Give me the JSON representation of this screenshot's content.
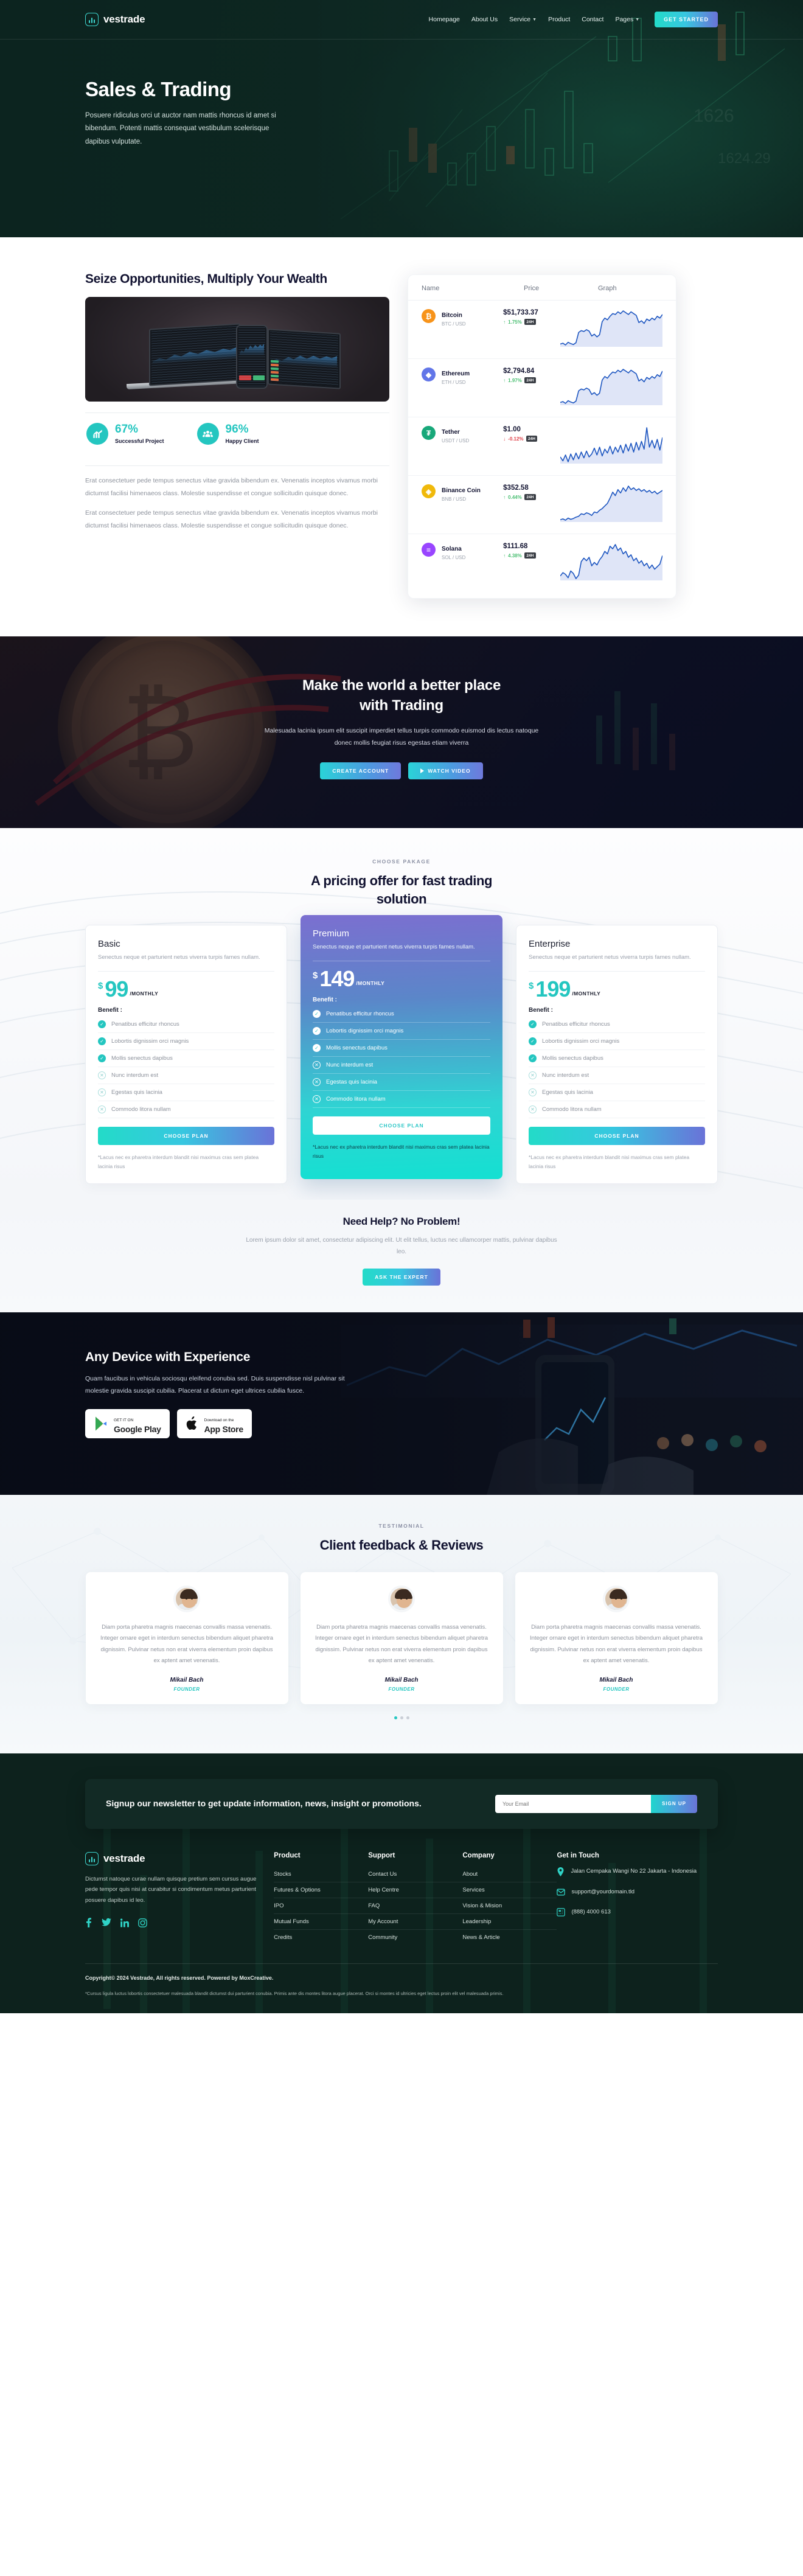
{
  "nav": {
    "brand": "vestrade",
    "items": [
      {
        "label": "Homepage",
        "caret": false
      },
      {
        "label": "About Us",
        "caret": false
      },
      {
        "label": "Service",
        "caret": true
      },
      {
        "label": "Product",
        "caret": false
      },
      {
        "label": "Contact",
        "caret": false
      },
      {
        "label": "Pages",
        "caret": true
      }
    ],
    "cta": "GET STARTED"
  },
  "hero": {
    "title": "Sales & Trading",
    "subtitle": "Posuere ridiculus orci ut auctor nam mattis rhoncus id amet si bibendum. Potenti mattis consequat vestibulum scelerisque dapibus vulputate."
  },
  "seize": {
    "title": "Seize Opportunities, Multiply Your Wealth",
    "stats": [
      {
        "value": "67%",
        "label": "Successful Project",
        "icon": "growth-chart-icon"
      },
      {
        "value": "96%",
        "label": "Happy Client",
        "icon": "people-group-icon"
      }
    ],
    "paragraphs": [
      "Erat consectetuer pede tempus senectus vitae gravida bibendum ex. Venenatis inceptos vivamus morbi dictumst facilisi himenaeos class. Molestie suspendisse et congue sollicitudin quisque donec.",
      "Erat consectetuer pede tempus senectus vitae gravida bibendum ex. Venenatis inceptos vivamus morbi dictumst facilisi himenaeos class. Molestie suspendisse et congue sollicitudin quisque donec."
    ]
  },
  "crypto": {
    "headers": {
      "name": "Name",
      "price": "Price",
      "graph": "Graph"
    },
    "rows": [
      {
        "symbol": "₿",
        "color": "#f7931a",
        "name": "Bitcoin",
        "pair": "BTC / USD",
        "price": "$51,733.37",
        "change": "1.75%",
        "direction": "up",
        "period": "24H"
      },
      {
        "symbol": "◆",
        "color": "#6276e8",
        "name": "Ethereum",
        "pair": "ETH / USD",
        "price": "$2,794.84",
        "change": "1.97%",
        "direction": "up",
        "period": "24H"
      },
      {
        "symbol": "₮",
        "color": "#18a87a",
        "name": "Tether",
        "pair": "USDT / USD",
        "price": "$1.00",
        "change": "-0.12%",
        "direction": "down",
        "period": "24H"
      },
      {
        "symbol": "◈",
        "color": "#f0b90b",
        "name": "Binance Coin",
        "pair": "BNB / USD",
        "price": "$352.58",
        "change": "0.44%",
        "direction": "up",
        "period": "24H"
      },
      {
        "symbol": "≡",
        "color": "#9945ff",
        "name": "Solana",
        "pair": "SOL / USD",
        "price": "$111.68",
        "change": "4.38%",
        "direction": "up",
        "period": "24H"
      }
    ]
  },
  "trading_cta": {
    "title_line1": "Make the world a better place",
    "title_line2": "with Trading",
    "text": "Malesuada lacinia ipsum elit suscipit imperdiet tellus turpis commodo euismod dis lectus natoque donec mollis feugiat risus egestas etiam viverra",
    "btn_primary": "CREATE ACCOUNT",
    "btn_secondary": "WATCH VIDEO"
  },
  "pricing": {
    "eyebrow": "CHOOSE PAKAGE",
    "heading_line1": "A pricing offer for fast trading",
    "heading_line2": "solution",
    "note": "*Lacus nec ex pharetra interdum blandit nisi maximus cras sem platea lacinia risus",
    "benefit_title": "Benefit :",
    "button": "CHOOSE PLAN",
    "per": "/MONTHLY",
    "currency": "$",
    "plans": [
      {
        "name": "Basic",
        "desc": "Senectus neque et parturient netus viverra turpis fames nullam.",
        "amount": "99",
        "benefits": [
          {
            "text": "Penatibus efficitur rhoncus",
            "included": true
          },
          {
            "text": "Lobortis dignissim orci magnis",
            "included": true
          },
          {
            "text": "Mollis senectus dapibus",
            "included": true
          },
          {
            "text": "Nunc interdum est",
            "included": false
          },
          {
            "text": "Egestas quis lacinia",
            "included": false
          },
          {
            "text": "Commodo litora nullam",
            "included": false
          }
        ]
      },
      {
        "name": "Premium",
        "desc": "Senectus neque et parturient netus viverra turpis fames nullam.",
        "amount": "149",
        "benefits": [
          {
            "text": "Penatibus efficitur rhoncus",
            "included": true
          },
          {
            "text": "Lobortis dignissim orci magnis",
            "included": true
          },
          {
            "text": "Mollis senectus dapibus",
            "included": true
          },
          {
            "text": "Nunc interdum est",
            "included": false
          },
          {
            "text": "Egestas quis lacinia",
            "included": false
          },
          {
            "text": "Commodo litora nullam",
            "included": false
          }
        ]
      },
      {
        "name": "Enterprise",
        "desc": "Senectus neque et parturient netus viverra turpis fames nullam.",
        "amount": "199",
        "benefits": [
          {
            "text": "Penatibus efficitur rhoncus",
            "included": true
          },
          {
            "text": "Lobortis dignissim orci magnis",
            "included": true
          },
          {
            "text": "Mollis senectus dapibus",
            "included": true
          },
          {
            "text": "Nunc interdum est",
            "included": false
          },
          {
            "text": "Egestas quis lacinia",
            "included": false
          },
          {
            "text": "Commodo litora nullam",
            "included": false
          }
        ]
      }
    ]
  },
  "help": {
    "title": "Need Help? No Problem!",
    "text": "Lorem ipsum dolor sit amet, consectetur adipiscing elit. Ut elit tellus, luctus nec ullamcorper mattis, pulvinar dapibus leo.",
    "button": "ASK THE EXPERT"
  },
  "device": {
    "title": "Any Device with Experience",
    "text": "Quam faucibus in vehicula sociosqu eleifend conubia sed. Duis suspendisse nisl pulvinar sit molestie gravida suscipit cubilia. Placerat ut dictum eget ultrices cubilia fusce.",
    "stores": [
      {
        "small": "GET IT ON",
        "big": "Google Play",
        "icon": "google-play-icon"
      },
      {
        "small": "Download on the",
        "big": "App Store",
        "icon": "apple-icon"
      }
    ]
  },
  "testimonial": {
    "eyebrow": "TESTIMONIAL",
    "heading": "Client feedback & Reviews",
    "cards": [
      {
        "quote": "Diam porta pharetra magnis maecenas convallis massa venenatis. Integer ornare eget in interdum senectus bibendum aliquet pharetra dignissim. Pulvinar netus non erat viverra elementum proin dapibus ex aptent amet venenatis.",
        "name": "Mikail Bach",
        "role": "FOUNDER"
      },
      {
        "quote": "Diam porta pharetra magnis maecenas convallis massa venenatis. Integer ornare eget in interdum senectus bibendum aliquet pharetra dignissim. Pulvinar netus non erat viverra elementum proin dapibus ex aptent amet venenatis.",
        "name": "Mikail Bach",
        "role": "FOUNDER"
      },
      {
        "quote": "Diam porta pharetra magnis maecenas convallis massa venenatis. Integer ornare eget in interdum senectus bibendum aliquet pharetra dignissim. Pulvinar netus non erat viverra elementum proin dapibus ex aptent amet venenatis.",
        "name": "Mikail Bach",
        "role": "FOUNDER"
      }
    ]
  },
  "newsletter": {
    "title": "Signup our newsletter to get update information, news, insight or promotions.",
    "placeholder": "Your Email",
    "button": "SIGN UP"
  },
  "footer": {
    "brand": "vestrade",
    "description": "Dictumst natoque curae nullam quisque pretium sem cursus augue pede tempor quis nisi at curabitur si condimentum metus parturient posuere dapibus id leo.",
    "socials": [
      "facebook-icon",
      "twitter-icon",
      "linkedin-icon",
      "instagram-icon"
    ],
    "columns": [
      {
        "title": "Product",
        "links": [
          "Stocks",
          "Futures & Options",
          "IPO",
          "Mutual Funds",
          "Credits"
        ]
      },
      {
        "title": "Support",
        "links": [
          "Contact Us",
          "Help Centre",
          "FAQ",
          "My Account",
          "Community"
        ]
      },
      {
        "title": "Company",
        "links": [
          "About",
          "Services",
          "Vision & Mision",
          "Leadership",
          "News & Article"
        ]
      }
    ],
    "touch_title": "Get in Touch",
    "touch": [
      {
        "icon": "location-pin-icon",
        "text": "Jalan Cempaka Wangi No 22 Jakarta - Indonesia"
      },
      {
        "icon": "envelope-icon",
        "text": "support@yourdomain.tld"
      },
      {
        "icon": "fax-icon",
        "text": "(888) 4000 613"
      }
    ],
    "copyright": "Copyright© 2024 Vestrade, All rights reserved. Powered by MoxCreative.",
    "disclaimer": "*Cursus ligula luctus lobortis consectetuer malesuada blandit dictumst dui parturient conubia. Primis ante dis montes litora augue placerat. Orci si montes id ultricies eget lectus proin elit vel malesuada primis."
  },
  "chart_data": [
    {
      "type": "line",
      "name": "Bitcoin",
      "values": [
        12,
        14,
        10,
        16,
        13,
        11,
        15,
        38,
        42,
        40,
        44,
        41,
        30,
        34,
        28,
        33,
        62,
        70,
        66,
        74,
        80,
        78,
        84,
        80,
        86,
        82,
        78,
        84,
        80,
        76,
        60,
        64,
        58,
        68,
        64,
        70,
        66,
        74,
        70,
        78
      ]
    },
    {
      "type": "line",
      "name": "Ethereum",
      "values": [
        10,
        12,
        8,
        14,
        11,
        9,
        13,
        36,
        40,
        38,
        42,
        39,
        28,
        32,
        26,
        31,
        60,
        68,
        64,
        72,
        78,
        76,
        82,
        78,
        84,
        80,
        76,
        82,
        78,
        74,
        58,
        62,
        56,
        66,
        62,
        68,
        64,
        72,
        68,
        80
      ]
    },
    {
      "type": "line",
      "name": "Tether",
      "values": [
        30,
        22,
        34,
        20,
        36,
        24,
        38,
        26,
        40,
        28,
        42,
        30,
        36,
        48,
        34,
        50,
        32,
        46,
        38,
        52,
        36,
        50,
        40,
        54,
        38,
        56,
        42,
        58,
        40,
        60,
        44,
        62,
        46,
        90,
        50,
        64,
        48,
        66,
        44,
        70
      ]
    },
    {
      "type": "line",
      "name": "Binance Coin",
      "values": [
        8,
        10,
        7,
        12,
        9,
        11,
        14,
        16,
        22,
        20,
        24,
        22,
        18,
        26,
        24,
        30,
        34,
        40,
        46,
        58,
        72,
        64,
        78,
        70,
        82,
        74,
        86,
        78,
        82,
        76,
        80,
        74,
        78,
        72,
        76,
        70,
        74,
        68,
        72,
        76
      ]
    },
    {
      "type": "line",
      "name": "Solana",
      "values": [
        14,
        22,
        18,
        10,
        26,
        20,
        8,
        16,
        48,
        56,
        50,
        58,
        38,
        46,
        40,
        52,
        60,
        72,
        66,
        84,
        78,
        88,
        74,
        80,
        66,
        72,
        58,
        64,
        50,
        56,
        44,
        50,
        38,
        44,
        32,
        40,
        30,
        36,
        42,
        62
      ]
    }
  ]
}
